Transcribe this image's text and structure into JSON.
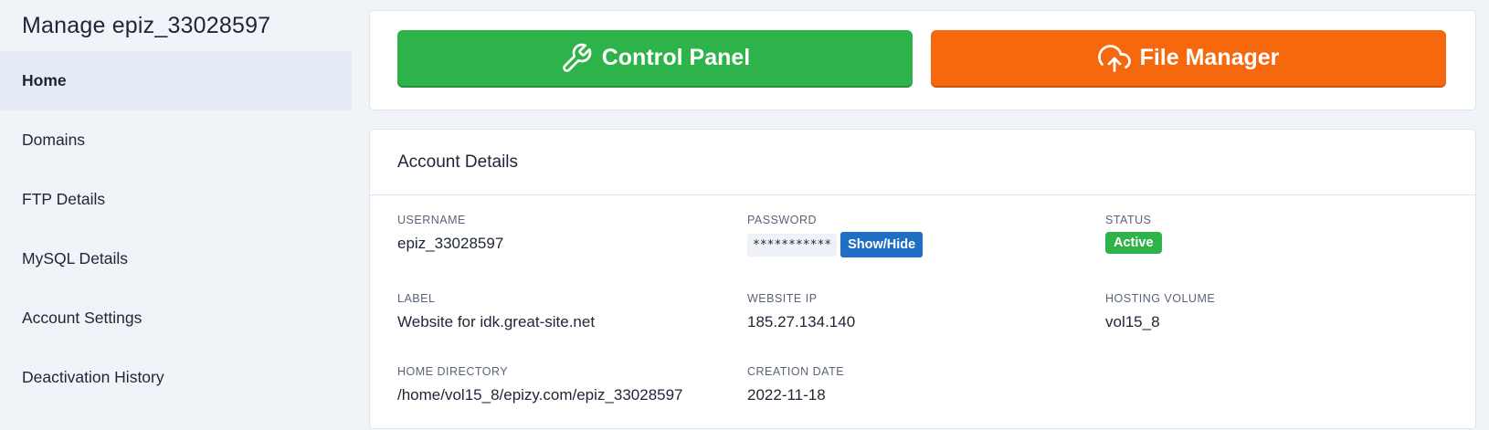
{
  "sidebar": {
    "title": "Manage epiz_33028597",
    "items": [
      {
        "label": "Home"
      },
      {
        "label": "Domains"
      },
      {
        "label": "FTP Details"
      },
      {
        "label": "MySQL Details"
      },
      {
        "label": "Account Settings"
      },
      {
        "label": "Deactivation History"
      }
    ]
  },
  "actions": {
    "control_panel": {
      "label": "Control Panel",
      "icon": "wrench-icon",
      "color": "#2db34a"
    },
    "file_manager": {
      "label": "File Manager",
      "icon": "cloud-upload-icon",
      "color": "#f6680d"
    }
  },
  "account": {
    "heading": "Account Details",
    "username": {
      "label": "USERNAME",
      "value": "epiz_33028597"
    },
    "password": {
      "label": "PASSWORD",
      "mask": "***********",
      "button": "Show/Hide"
    },
    "status": {
      "label": "STATUS",
      "value": "Active",
      "color": "#2db34a"
    },
    "label": {
      "label": "LABEL",
      "value": "Website for idk.great-site.net"
    },
    "website_ip": {
      "label": "WEBSITE IP",
      "value": "185.27.134.140"
    },
    "hosting_volume": {
      "label": "HOSTING VOLUME",
      "value": "vol15_8"
    },
    "home_directory": {
      "label": "HOME DIRECTORY",
      "value": "/home/vol15_8/epizy.com/epiz_33028597"
    },
    "creation_date": {
      "label": "CREATION DATE",
      "value": "2022-11-18"
    }
  }
}
